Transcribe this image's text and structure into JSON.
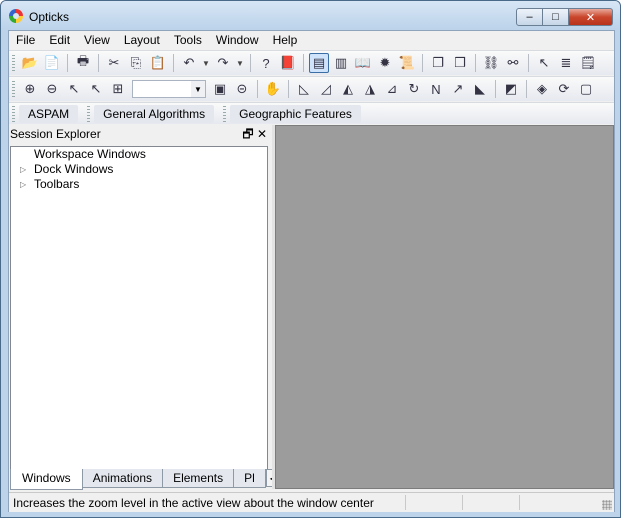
{
  "window": {
    "title": "Opticks"
  },
  "titlebar_buttons": {
    "minimize": "–",
    "maximize": "□",
    "close": "✕"
  },
  "menu": [
    "File",
    "Edit",
    "View",
    "Layout",
    "Tools",
    "Window",
    "Help"
  ],
  "toolbar1": {
    "icons": [
      "open-folder-icon",
      "new-document-icon",
      "print-icon",
      "cut-icon",
      "copy-icon",
      "paste-icon",
      "undo-icon",
      "redo-icon",
      "help-icon",
      "book-icon",
      "session-explorer-icon",
      "histogram-icon",
      "open-book-icon",
      "puzzle-icon",
      "scroll-icon",
      "tile-windows-icon",
      "cascade-windows-icon",
      "link-icon",
      "unlink-icon",
      "select-arrow-icon",
      "layers-icon",
      "properties-icon"
    ],
    "glyphs": [
      "📂",
      "📄",
      "🖶",
      "✂",
      "⎘",
      "📋",
      "↶",
      "↷",
      "?",
      "📕",
      "▤",
      "▥",
      "📖",
      "✹",
      "📜",
      "❐",
      "❒",
      "⛓",
      "⚯",
      "↖",
      "≣",
      "🗒"
    ]
  },
  "toolbar2": {
    "icons": [
      "zoom-in-icon",
      "zoom-out-icon",
      "zoom-point-in-icon",
      "zoom-point-out-icon",
      "zoom-rect-icon",
      "zoom-to-fit-icon",
      "zoom-extents-icon",
      "pan-hand-icon",
      "rotate-left-icon",
      "rotate-right-icon",
      "flip-horizontal-icon",
      "flip-vertical-icon",
      "free-rotate-icon",
      "reset-rotate-icon",
      "north-arrow-icon",
      "east-arrow-icon",
      "measure-icon",
      "slope-icon",
      "gcp-icon",
      "refresh-icon",
      "frame-icon"
    ],
    "glyphs": [
      "⊕",
      "⊖",
      "↖",
      "↖",
      "⊞",
      "▣",
      "⊝",
      "✋",
      "◺",
      "◿",
      "◭",
      "◮",
      "⊿",
      "↻",
      "N",
      "↗",
      "◣",
      "◩",
      "◈",
      "⟳",
      "▢"
    ],
    "zoom_value": ""
  },
  "plugin_tabs": [
    "ASPAM",
    "General Algorithms",
    "Geographic Features"
  ],
  "explorer": {
    "title": "Session Explorer",
    "float_icon": "🗗",
    "close_icon": "✕",
    "tree": [
      {
        "label": "Workspace Windows",
        "expandable": false
      },
      {
        "label": "Dock Windows",
        "expandable": true
      },
      {
        "label": "Toolbars",
        "expandable": true
      }
    ],
    "tabs": [
      "Windows",
      "Animations",
      "Elements",
      "Pl"
    ],
    "active_tab": "Windows",
    "scroll_left": "◀",
    "scroll_right": "▶"
  },
  "status": {
    "message": "Increases the zoom level in the active view about the window center"
  }
}
